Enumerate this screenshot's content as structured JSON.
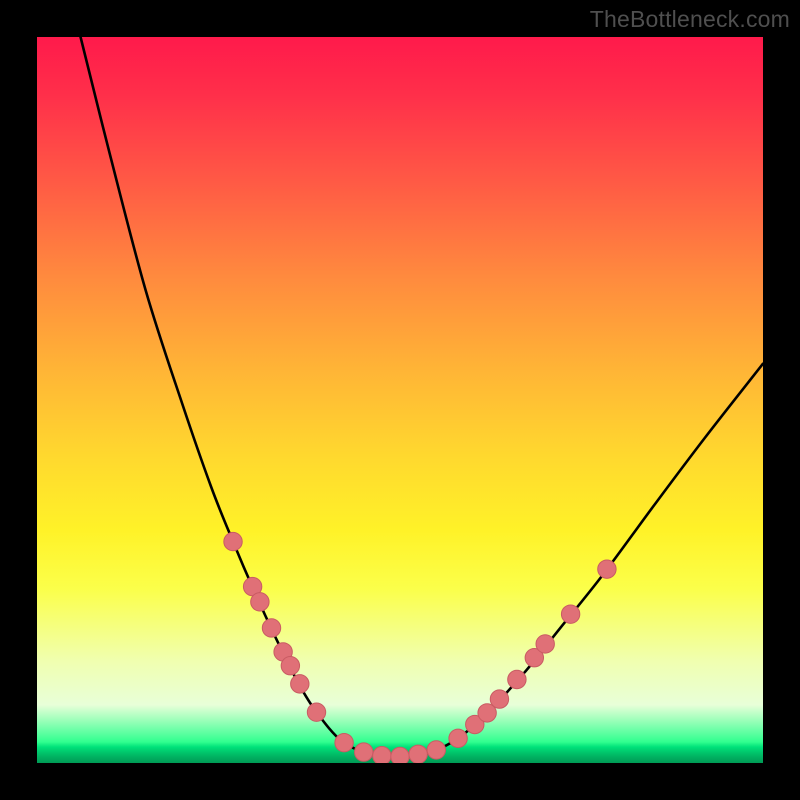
{
  "watermark": "TheBottleneck.com",
  "colors": {
    "background": "#000000",
    "curve": "#000000",
    "dot_fill": "#e07077",
    "dot_stroke": "#c95b63"
  },
  "chart_data": {
    "type": "line",
    "title": "",
    "xlabel": "",
    "ylabel": "",
    "xlim": [
      0,
      100
    ],
    "ylim": [
      0,
      100
    ],
    "note": "Axes are unlabeled in the source image; values below are estimated normalized percentages read from the rendered curve (x = horizontal position 0–100, y = height 0–100, with 100 at top).",
    "series": [
      {
        "name": "main-curve",
        "x": [
          6,
          10,
          15,
          20,
          24,
          27,
          30,
          33,
          36,
          38.5,
          42,
          46,
          50,
          54,
          58,
          62,
          67,
          72,
          78,
          85,
          92,
          100
        ],
        "y": [
          100,
          84,
          65,
          49.5,
          38,
          30.5,
          23.5,
          17,
          11,
          7,
          3,
          1.2,
          0.8,
          1.4,
          3.4,
          6.9,
          12.3,
          18.5,
          26,
          35.5,
          44.8,
          55
        ]
      }
    ],
    "dots": {
      "name": "highlight-dots",
      "note": "Pink bead clusters along the lower arms and valley of the curve; positions estimated (0–100 scale).",
      "points": [
        {
          "x": 27.0,
          "y": 30.5
        },
        {
          "x": 29.7,
          "y": 24.3
        },
        {
          "x": 30.7,
          "y": 22.2
        },
        {
          "x": 32.3,
          "y": 18.6
        },
        {
          "x": 33.9,
          "y": 15.3
        },
        {
          "x": 34.9,
          "y": 13.4
        },
        {
          "x": 36.2,
          "y": 10.9
        },
        {
          "x": 38.5,
          "y": 7.0
        },
        {
          "x": 42.3,
          "y": 2.8
        },
        {
          "x": 45.0,
          "y": 1.5
        },
        {
          "x": 47.5,
          "y": 1.0
        },
        {
          "x": 50.0,
          "y": 0.9
        },
        {
          "x": 52.5,
          "y": 1.2
        },
        {
          "x": 55.0,
          "y": 1.8
        },
        {
          "x": 58.0,
          "y": 3.4
        },
        {
          "x": 60.3,
          "y": 5.3
        },
        {
          "x": 62.0,
          "y": 6.9
        },
        {
          "x": 63.7,
          "y": 8.8
        },
        {
          "x": 66.1,
          "y": 11.5
        },
        {
          "x": 68.5,
          "y": 14.5
        },
        {
          "x": 70.0,
          "y": 16.4
        },
        {
          "x": 73.5,
          "y": 20.5
        },
        {
          "x": 78.5,
          "y": 26.7
        }
      ]
    }
  }
}
